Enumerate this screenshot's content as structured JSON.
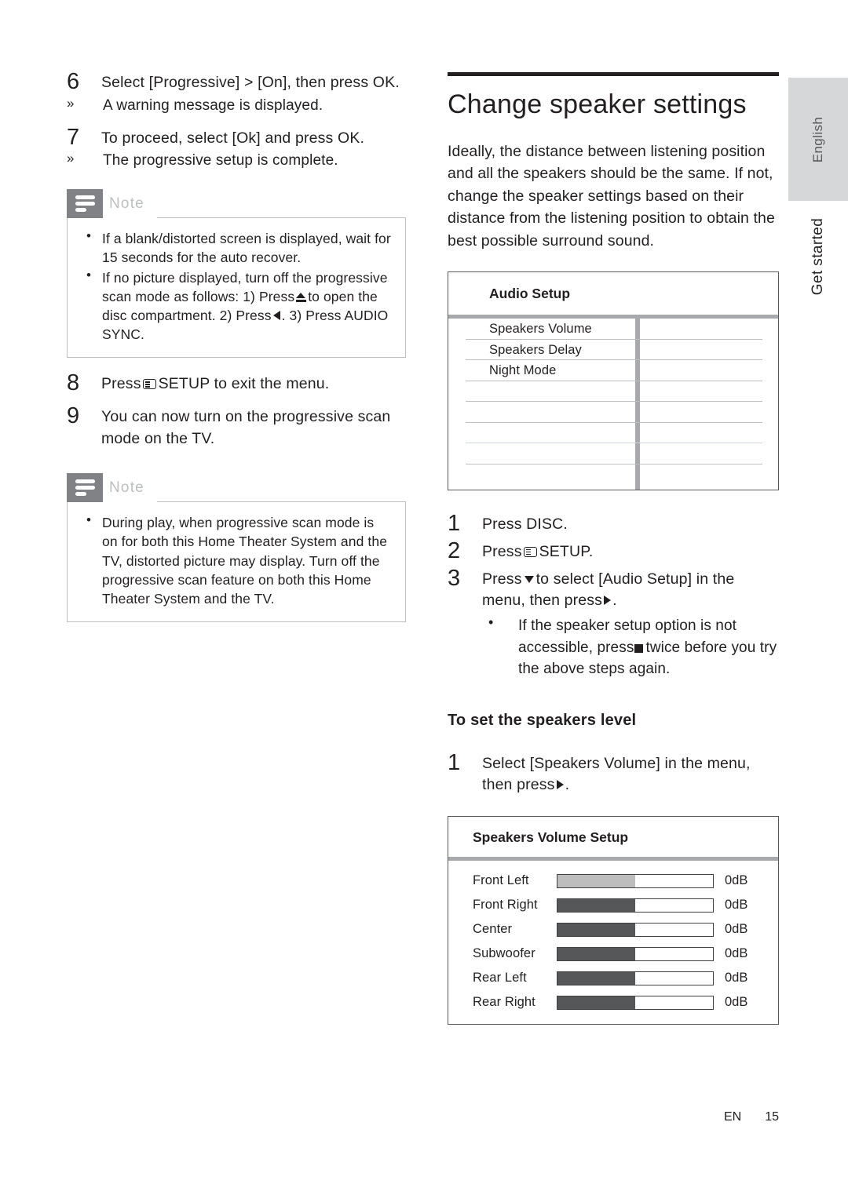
{
  "colors": {
    "note_header_bg": "#808285",
    "note_title": "#bcbec0",
    "side_tab_bg": "#d5d7d9",
    "screen_border": "#58595b",
    "screen_bar": "#a7a9ac",
    "bar_fill_selected": "#bdbdbd",
    "bar_fill_normal": "#555759",
    "rule": "#231f20"
  },
  "side": {
    "language_tab": "English",
    "chapter_tab": "Get started"
  },
  "left_column": {
    "steps": [
      {
        "num": "6",
        "text": "Select [Progressive] > [On], then press OK.",
        "subs": [
          {
            "mark": "»",
            "text": "A warning message is displayed."
          }
        ]
      },
      {
        "num": "7",
        "text": "To proceed, select [Ok] and press OK.",
        "subs": [
          {
            "mark": "»",
            "text": "The progressive setup is complete."
          }
        ]
      }
    ],
    "note_1": {
      "title": "Note",
      "items": [
        "If a blank/distorted screen is displayed, wait for 15 seconds for the auto recover.",
        "If no picture displayed, turn off the progressive scan mode as follows: 1) Press &#9650; to open the disc compartment. 2) Press &#9668;. 3) Press AUDIO SYNC."
      ],
      "item2_part1": "If no picture displayed, turn off the progressive scan mode as follows: 1) Press",
      "item2_part2": "to open the disc compartment. 2) Press",
      "item2_part3": ". 3) Press AUDIO SYNC."
    },
    "steps_2": [
      {
        "num": "8",
        "text_before": "Press",
        "text_after": "SETUP to exit the menu."
      },
      {
        "num": "9",
        "text": "You can now turn on the progressive scan mode on the TV."
      }
    ],
    "note_2": {
      "title": "Note",
      "items": [
        "During play, when progressive scan mode is on for both this Home Theater System and the TV, distorted picture may display. Turn off the progressive scan feature on both this Home Theater System and the TV."
      ]
    }
  },
  "right_column": {
    "heading": "Change speaker settings",
    "intro": "Ideally, the distance between listening position and all the speakers should be the same. If not, change the speaker settings based on their distance from the listening position to obtain the best possible surround sound.",
    "audio_setup_screen": {
      "title": "Audio Setup",
      "rows": [
        {
          "label": "Speakers Volume",
          "value": ""
        },
        {
          "label": "Speakers Delay",
          "value": ""
        },
        {
          "label": "Night Mode",
          "value": ""
        },
        {
          "label": "",
          "value": ""
        },
        {
          "label": "",
          "value": ""
        },
        {
          "label": "",
          "value": ""
        },
        {
          "label": "",
          "value": ""
        },
        {
          "label": "",
          "value": ""
        }
      ]
    },
    "steps": [
      {
        "num": "1",
        "text": "Press DISC."
      },
      {
        "num": "2",
        "text_before": "Press",
        "text_after": "SETUP."
      },
      {
        "num": "3",
        "text_before": "Press",
        "text_mid": "to select [Audio Setup] in the menu, then press",
        "text_after": ".",
        "sub_before": "If the speaker setup option is not accessible, press",
        "sub_after": "twice before you try the above steps again."
      }
    ],
    "subheading": "To set the speakers level",
    "level_step": {
      "num": "1",
      "text_before": "Select [Speakers Volume] in the menu, then press",
      "text_after": "."
    },
    "volume_screen": {
      "title": "Speakers Volume Setup",
      "rows": [
        {
          "label": "Front Left",
          "value": "0dB",
          "fill_pct": 50,
          "selected": true
        },
        {
          "label": "Front Right",
          "value": "0dB",
          "fill_pct": 50,
          "selected": false
        },
        {
          "label": "Center",
          "value": "0dB",
          "fill_pct": 50,
          "selected": false
        },
        {
          "label": "Subwoofer",
          "value": "0dB",
          "fill_pct": 50,
          "selected": false
        },
        {
          "label": "Rear Left",
          "value": "0dB",
          "fill_pct": 50,
          "selected": false
        },
        {
          "label": "Rear Right",
          "value": "0dB",
          "fill_pct": 50,
          "selected": false
        }
      ]
    }
  },
  "footer": {
    "language_code": "EN",
    "page_number": "15"
  }
}
